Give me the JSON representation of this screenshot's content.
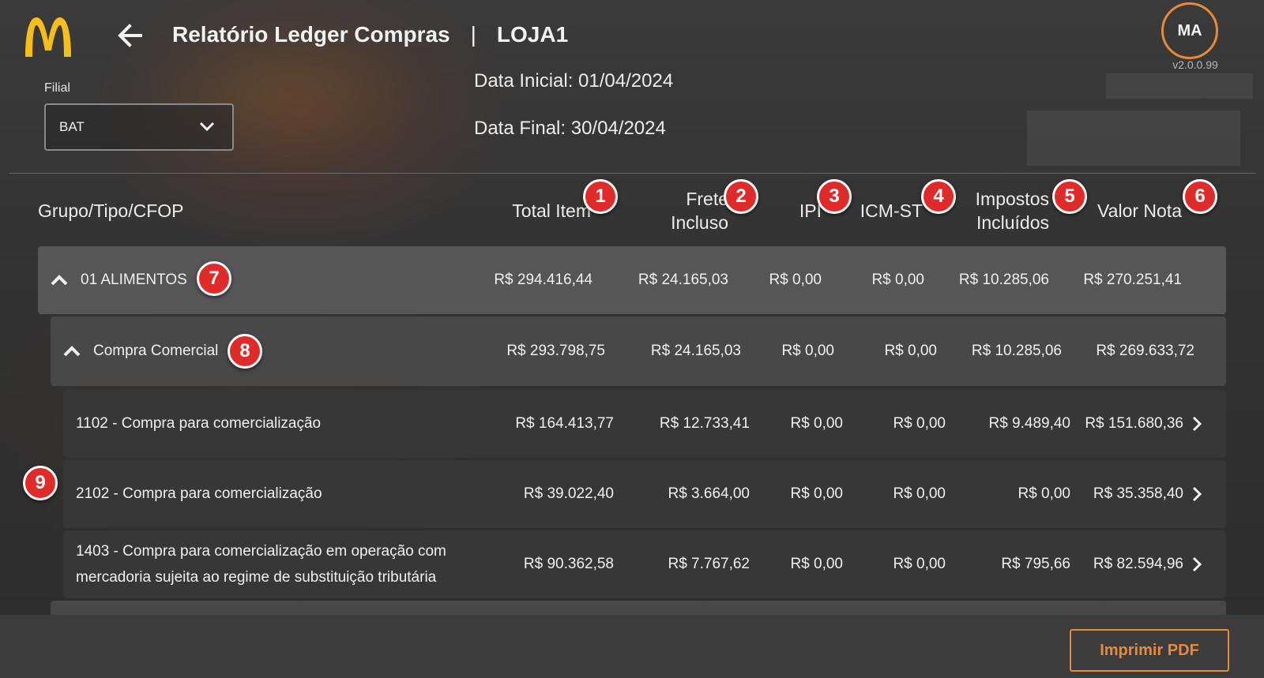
{
  "header": {
    "title": "Relatório Ledger Compras",
    "separator": "|",
    "store": "LOJA1",
    "avatar_initials": "MA",
    "version": "v2.0.0.99"
  },
  "filters": {
    "filial_label": "Filial",
    "filial_value": "BAT",
    "data_inicial": "Data Inicial: 01/04/2024",
    "data_final": "Data Final: 30/04/2024"
  },
  "columns": {
    "group": "Grupo/Tipo/CFOP",
    "total_item": "Total Item",
    "frete_line1": "Frete",
    "frete_line2": "Incluso",
    "ipi": "IPI",
    "icm_st": "ICM-ST",
    "impostos_line1": "Impostos",
    "impostos_line2": "Incluídos",
    "valor_nota": "Valor Nota"
  },
  "badges": [
    "1",
    "2",
    "3",
    "4",
    "5",
    "6",
    "7",
    "8",
    "9"
  ],
  "rows": [
    {
      "label": "01 ALIMENTOS",
      "total": "R$ 294.416,44",
      "frete": "R$ 24.165,03",
      "ipi": "R$ 0,00",
      "icm": "R$ 0,00",
      "impostos": "R$ 10.285,06",
      "valor": "R$ 270.251,41"
    },
    {
      "label": "Compra Comercial",
      "total": "R$ 293.798,75",
      "frete": "R$ 24.165,03",
      "ipi": "R$ 0,00",
      "icm": "R$ 0,00",
      "impostos": "R$ 10.285,06",
      "valor": "R$ 269.633,72"
    },
    {
      "label": "1102 - Compra para comercialização",
      "total": "R$ 164.413,77",
      "frete": "R$ 12.733,41",
      "ipi": "R$ 0,00",
      "icm": "R$ 0,00",
      "impostos": "R$ 9.489,40",
      "valor": "R$ 151.680,36"
    },
    {
      "label": "2102 - Compra para comercialização",
      "total": "R$ 39.022,40",
      "frete": "R$ 3.664,00",
      "ipi": "R$ 0,00",
      "icm": "R$ 0,00",
      "impostos": "R$ 0,00",
      "valor": "R$ 35.358,40"
    },
    {
      "label": "1403 - Compra para comercialização em operação com mercadoria sujeita ao regime de substituição tributária",
      "total": "R$ 90.362,58",
      "frete": "R$ 7.767,62",
      "ipi": "R$ 0,00",
      "icm": "R$ 0,00",
      "impostos": "R$ 795,66",
      "valor": "R$ 82.594,96"
    }
  ],
  "footer": {
    "print_label": "Imprimir PDF"
  },
  "colors": {
    "accent": "#e98a3a",
    "logo": "#f6be1a",
    "badge": "#e02b2b"
  }
}
